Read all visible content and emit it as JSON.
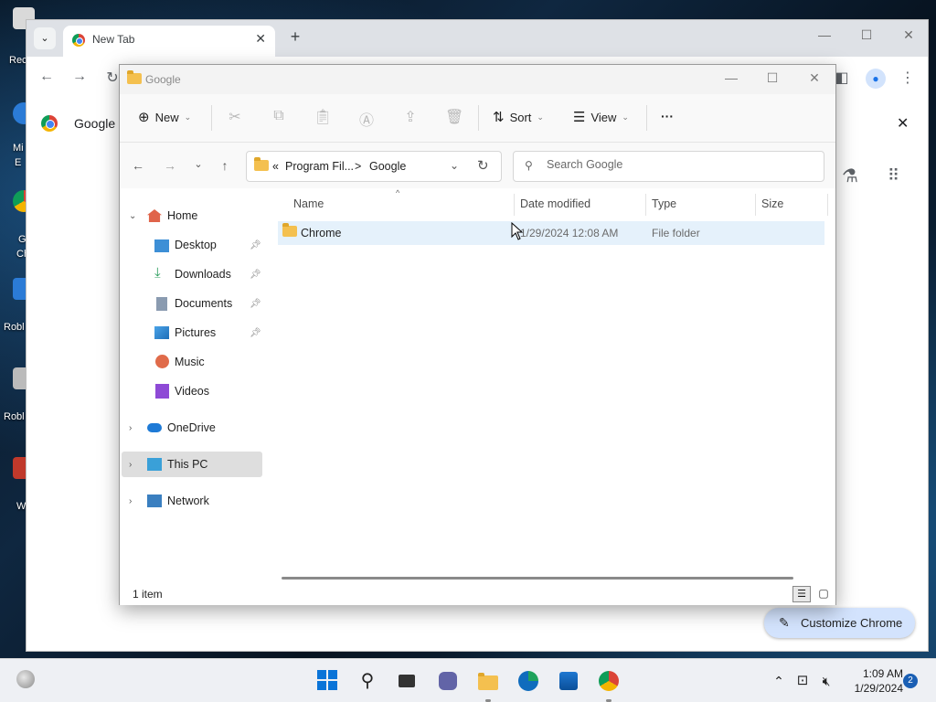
{
  "desktop": {
    "icons": [
      {
        "label": "Rec",
        "color": "#c8c8c8"
      },
      {
        "label": "Mi",
        "label2": "E",
        "color": "#2b7bd6"
      },
      {
        "label": "G",
        "label2": "Ch",
        "color": "#db4437"
      },
      {
        "label": "Robl",
        "color": "#2b7bd6"
      },
      {
        "label": "Robl",
        "color": "#bbbbbb"
      },
      {
        "label": "W",
        "color": "#c0392b"
      }
    ]
  },
  "chrome": {
    "tab_title": "New Tab",
    "tab_close": "✕",
    "new_tab": "+",
    "tab_search": "⌄",
    "google_row_text": "Google C",
    "customize_label": "Customize Chrome"
  },
  "explorer": {
    "title": "Google",
    "commands": {
      "new_label": "New",
      "sort_label": "Sort",
      "view_label": "View",
      "more_label": "···"
    },
    "address": {
      "prefix": "«",
      "segment1": "Program Fil...",
      "separator": ">",
      "segment2": "Google"
    },
    "search_placeholder": "Search Google",
    "nav_pane": {
      "home": "Home",
      "quick_access": [
        {
          "label": "Desktop",
          "icon": "desktop-icon",
          "pinned": true
        },
        {
          "label": "Downloads",
          "icon": "downloads-icon",
          "pinned": true
        },
        {
          "label": "Documents",
          "icon": "documents-icon",
          "pinned": true
        },
        {
          "label": "Pictures",
          "icon": "pictures-icon",
          "pinned": true
        },
        {
          "label": "Music",
          "icon": "music-icon",
          "pinned": false
        },
        {
          "label": "Videos",
          "icon": "videos-icon",
          "pinned": false
        }
      ],
      "onedrive": "OneDrive",
      "this_pc": "This PC",
      "network": "Network"
    },
    "columns": [
      "Name",
      "Date modified",
      "Type",
      "Size"
    ],
    "rows": [
      {
        "name": "Chrome",
        "date_modified": "1/29/2024 12:08 AM",
        "type": "File folder",
        "size": ""
      }
    ],
    "status": "1 item"
  },
  "taskbar": {
    "time": "1:09 AM",
    "date": "1/29/2024",
    "notification_count": "2"
  },
  "colors": {
    "accent": "#0067c0",
    "selection": "#e5f1fb",
    "folder": "#f4c04f",
    "chrome_chip": "#d3e3fd"
  }
}
